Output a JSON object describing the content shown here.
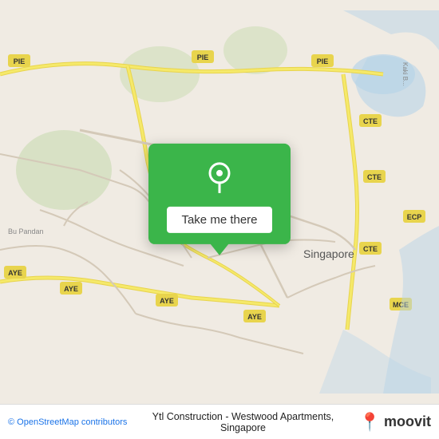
{
  "map": {
    "background_color": "#f0ebe3",
    "attribution": "© OpenStreetMap contributors"
  },
  "popup": {
    "button_label": "Take me there",
    "pin_icon": "📍"
  },
  "bottom_bar": {
    "attribution_text": "© OpenStreetMap contributors",
    "place_name": "Ytl Construction - Westwood Apartments, Singapore",
    "moovit_label": "moovit",
    "moovit_pin": "📍"
  }
}
